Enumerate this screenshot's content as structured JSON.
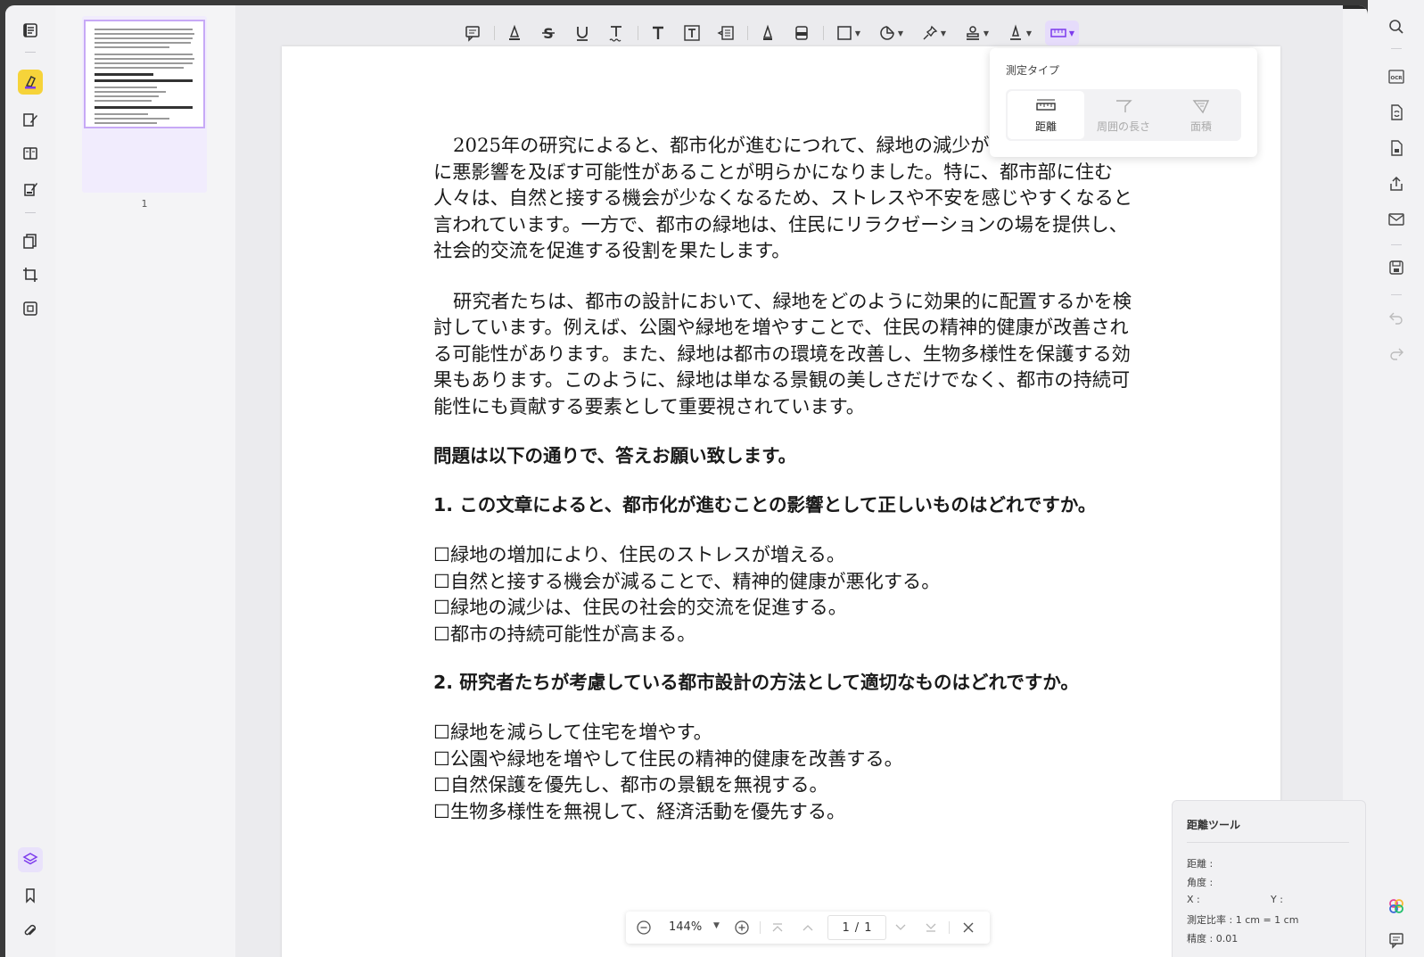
{
  "document": {
    "paragraphs": [
      "2025年の研究によると、都市化が進むにつれて、緑地の減少が人々の精神的健康に悪影響を及ぼす可能性があることが明らかになりました。特に、都市部に住む人々は、自然と接する機会が少なくなるため、ストレスや不安を感じやすくなると言われています。一方で、都市の緑地は、住民にリラクゼーションの場を提供し、社会的交流を促進する役割を果たします。",
      "研究者たちは、都市の設計において、緑地をどのように効果的に配置するかを検討しています。例えば、公園や緑地を増やすことで、住民の精神的健康が改善される可能性があります。また、緑地は都市の環境を改善し、生物多様性を保護する効果もあります。このように、緑地は単なる景観の美しさだけでなく、都市の持続可能性にも貢献する要素として重要視されています。"
    ],
    "heading": "問題は以下の通りで、答えお願い致します。",
    "questions": [
      {
        "title": "1.  この文章によると、都市化が進むことの影響として正しいものはどれですか。",
        "options": [
          "☐緑地の増加により、住民のストレスが増える。",
          "☐自然と接する機会が減ることで、精神的健康が悪化する。",
          "☐緑地の減少は、住民の社会的交流を促進する。",
          "☐都市の持続可能性が高まる。"
        ]
      },
      {
        "title": "2.  研究者たちが考慮している都市設計の方法として適切なものはどれですか。",
        "options": [
          "☐緑地を減らして住宅を増やす。",
          "☐公園や緑地を増やして住民の精神的健康を改善する。",
          "☐自然保護を優先し、都市の景観を無視する。",
          "☐生物多様性を無視して、経済活動を優先する。"
        ]
      }
    ]
  },
  "thumbnails": {
    "page_label": "1"
  },
  "measure_popover": {
    "title": "測定タイプ",
    "options": [
      {
        "label": "距離",
        "icon": "ruler-icon",
        "state": "selected"
      },
      {
        "label": "周囲の長さ",
        "icon": "perimeter-icon",
        "state": "disabled"
      },
      {
        "label": "面積",
        "icon": "area-icon",
        "state": "disabled"
      }
    ]
  },
  "distance_panel": {
    "title": "距離ツール",
    "distance_label": "距離 :",
    "angle_label": "角度 :",
    "x_label": "X :",
    "y_label": "Y :",
    "scale_label": "測定比率 : 1 cm = 1 cm",
    "precision_label": "精度 : 0.01"
  },
  "zoombar": {
    "zoom": "144%",
    "current_page": "1",
    "separator": "/",
    "total_pages": "1"
  },
  "toolbar": {
    "tools": [
      "comment-icon",
      "highlight-icon",
      "strikethrough-icon",
      "underline-icon",
      "squiggly-icon",
      "text-icon",
      "textbox-icon",
      "text-callout-icon",
      "pencil-icon",
      "eraser-icon",
      "shape-icon",
      "sticker-icon",
      "pin-icon",
      "stamp-icon",
      "signature-icon",
      "measure-icon"
    ],
    "active_tool": "measure-icon"
  },
  "colors": {
    "accent": "#8b5cf6",
    "active_highlight": "#f6d33a",
    "toolbar_active_bg": "#e6dcfb"
  }
}
